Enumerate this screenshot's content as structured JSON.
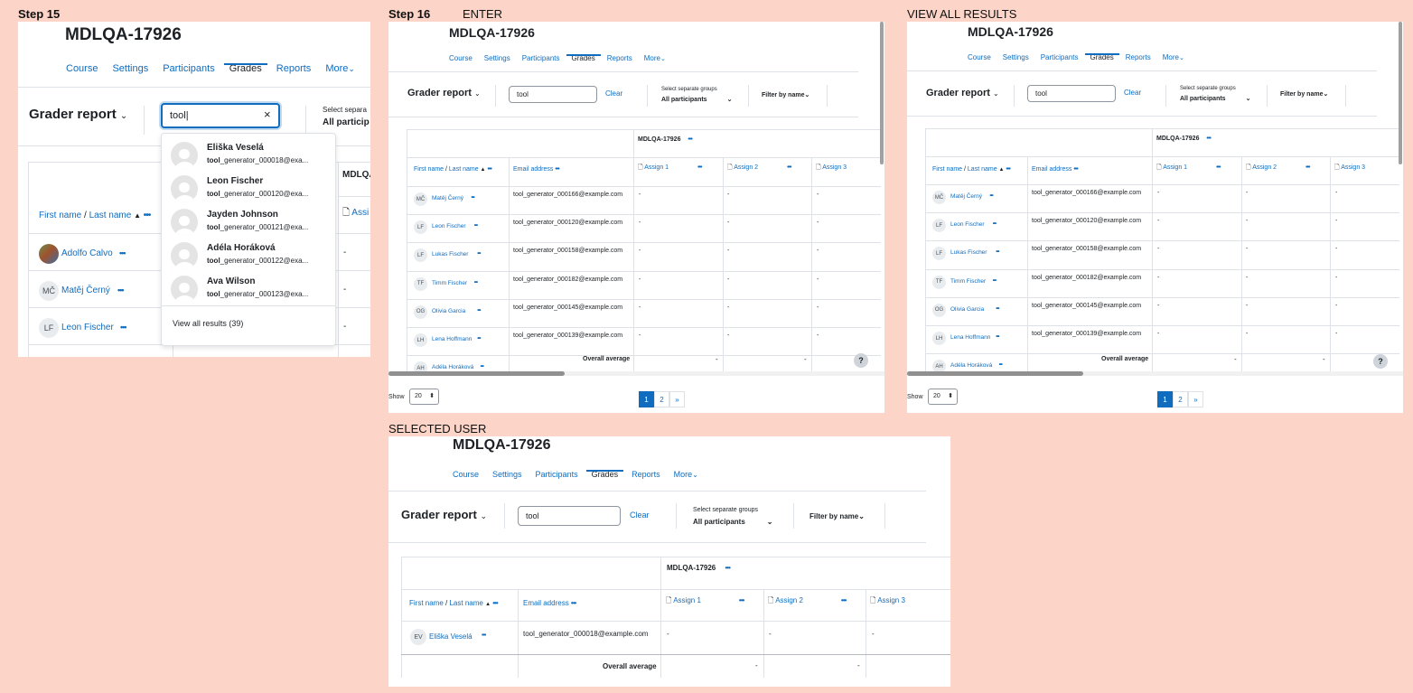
{
  "captions": {
    "step15": "Step 15",
    "step16": "Step 16",
    "enter": "ENTER",
    "view_all": "VIEW ALL RESULTS",
    "selected_user": "SELECTED USER"
  },
  "course_title": "MDLQA-17926",
  "nav": [
    "Course",
    "Settings",
    "Participants",
    "Grades",
    "Reports",
    "More"
  ],
  "grader_report_label": "Grader report",
  "search": {
    "value_typing": "tool|",
    "value": "tool",
    "clear_label": "Clear"
  },
  "groups": {
    "label_truncated": "Select separa",
    "value_truncated": "All particip",
    "label": "Select separate groups",
    "value": "All participants"
  },
  "filter_by_name": "Filter by name",
  "dropdown": {
    "items": [
      {
        "name": "Eliška Veselá",
        "match": "tool",
        "rest": "_generator_000018@exa..."
      },
      {
        "name": "Leon Fischer",
        "match": "tool",
        "rest": "_generator_000120@exa..."
      },
      {
        "name": "Jayden Johnson",
        "match": "tool",
        "rest": "_generator_000121@exa..."
      },
      {
        "name": "Adéla Horáková",
        "match": "tool",
        "rest": "_generator_000122@exa..."
      },
      {
        "name": "Ava Wilson",
        "match": "tool",
        "rest": "_generator_000123@exa..."
      }
    ],
    "view_all": "View all results (39)"
  },
  "table": {
    "course_col_truncated": "MDLQA",
    "course_col": "MDLQA-17926",
    "name_header_first": "First name",
    "name_header_sep": " / ",
    "name_header_last": "Last name",
    "email_header": "Email address",
    "assign_truncated": "Assi",
    "assignments": [
      "Assign 1",
      "Assign 2",
      "Assign 3"
    ],
    "overall_average": "Overall average",
    "dash": "-"
  },
  "step15_rows": [
    {
      "initials": "",
      "name": "Adolfo Calvo",
      "photo": true
    },
    {
      "initials": "MČ",
      "name": "Matěj Černý"
    },
    {
      "initials": "LF",
      "name": "Leon Fischer"
    }
  ],
  "rows": [
    {
      "initials": "MČ",
      "name": "Matěj Černý",
      "email": "tool_generator_000166@example.com"
    },
    {
      "initials": "LF",
      "name": "Leon Fischer",
      "email": "tool_generator_000120@example.com"
    },
    {
      "initials": "LF",
      "name": "Lukas Fischer",
      "email": "tool_generator_000158@example.com"
    },
    {
      "initials": "TF",
      "name": "Timm Fischer",
      "email": "tool_generator_000182@example.com"
    },
    {
      "initials": "OG",
      "name": "Olivia Garcia",
      "email": "tool_generator_000145@example.com"
    },
    {
      "initials": "LH",
      "name": "Lena Hoffmann",
      "email": "tool_generator_000139@example.com"
    },
    {
      "initials": "AH",
      "name": "Adéla Horáková",
      "email": ""
    }
  ],
  "selected_row": {
    "initials": "EV",
    "name": "Eliška Veselá",
    "email": "tool_generator_000018@example.com"
  },
  "pagination": {
    "show_label": "Show",
    "per_page": "20",
    "pages": [
      "1",
      "2",
      "»"
    ]
  },
  "help_symbol": "?",
  "clear_symbol": "×",
  "more_caret": "⌄"
}
